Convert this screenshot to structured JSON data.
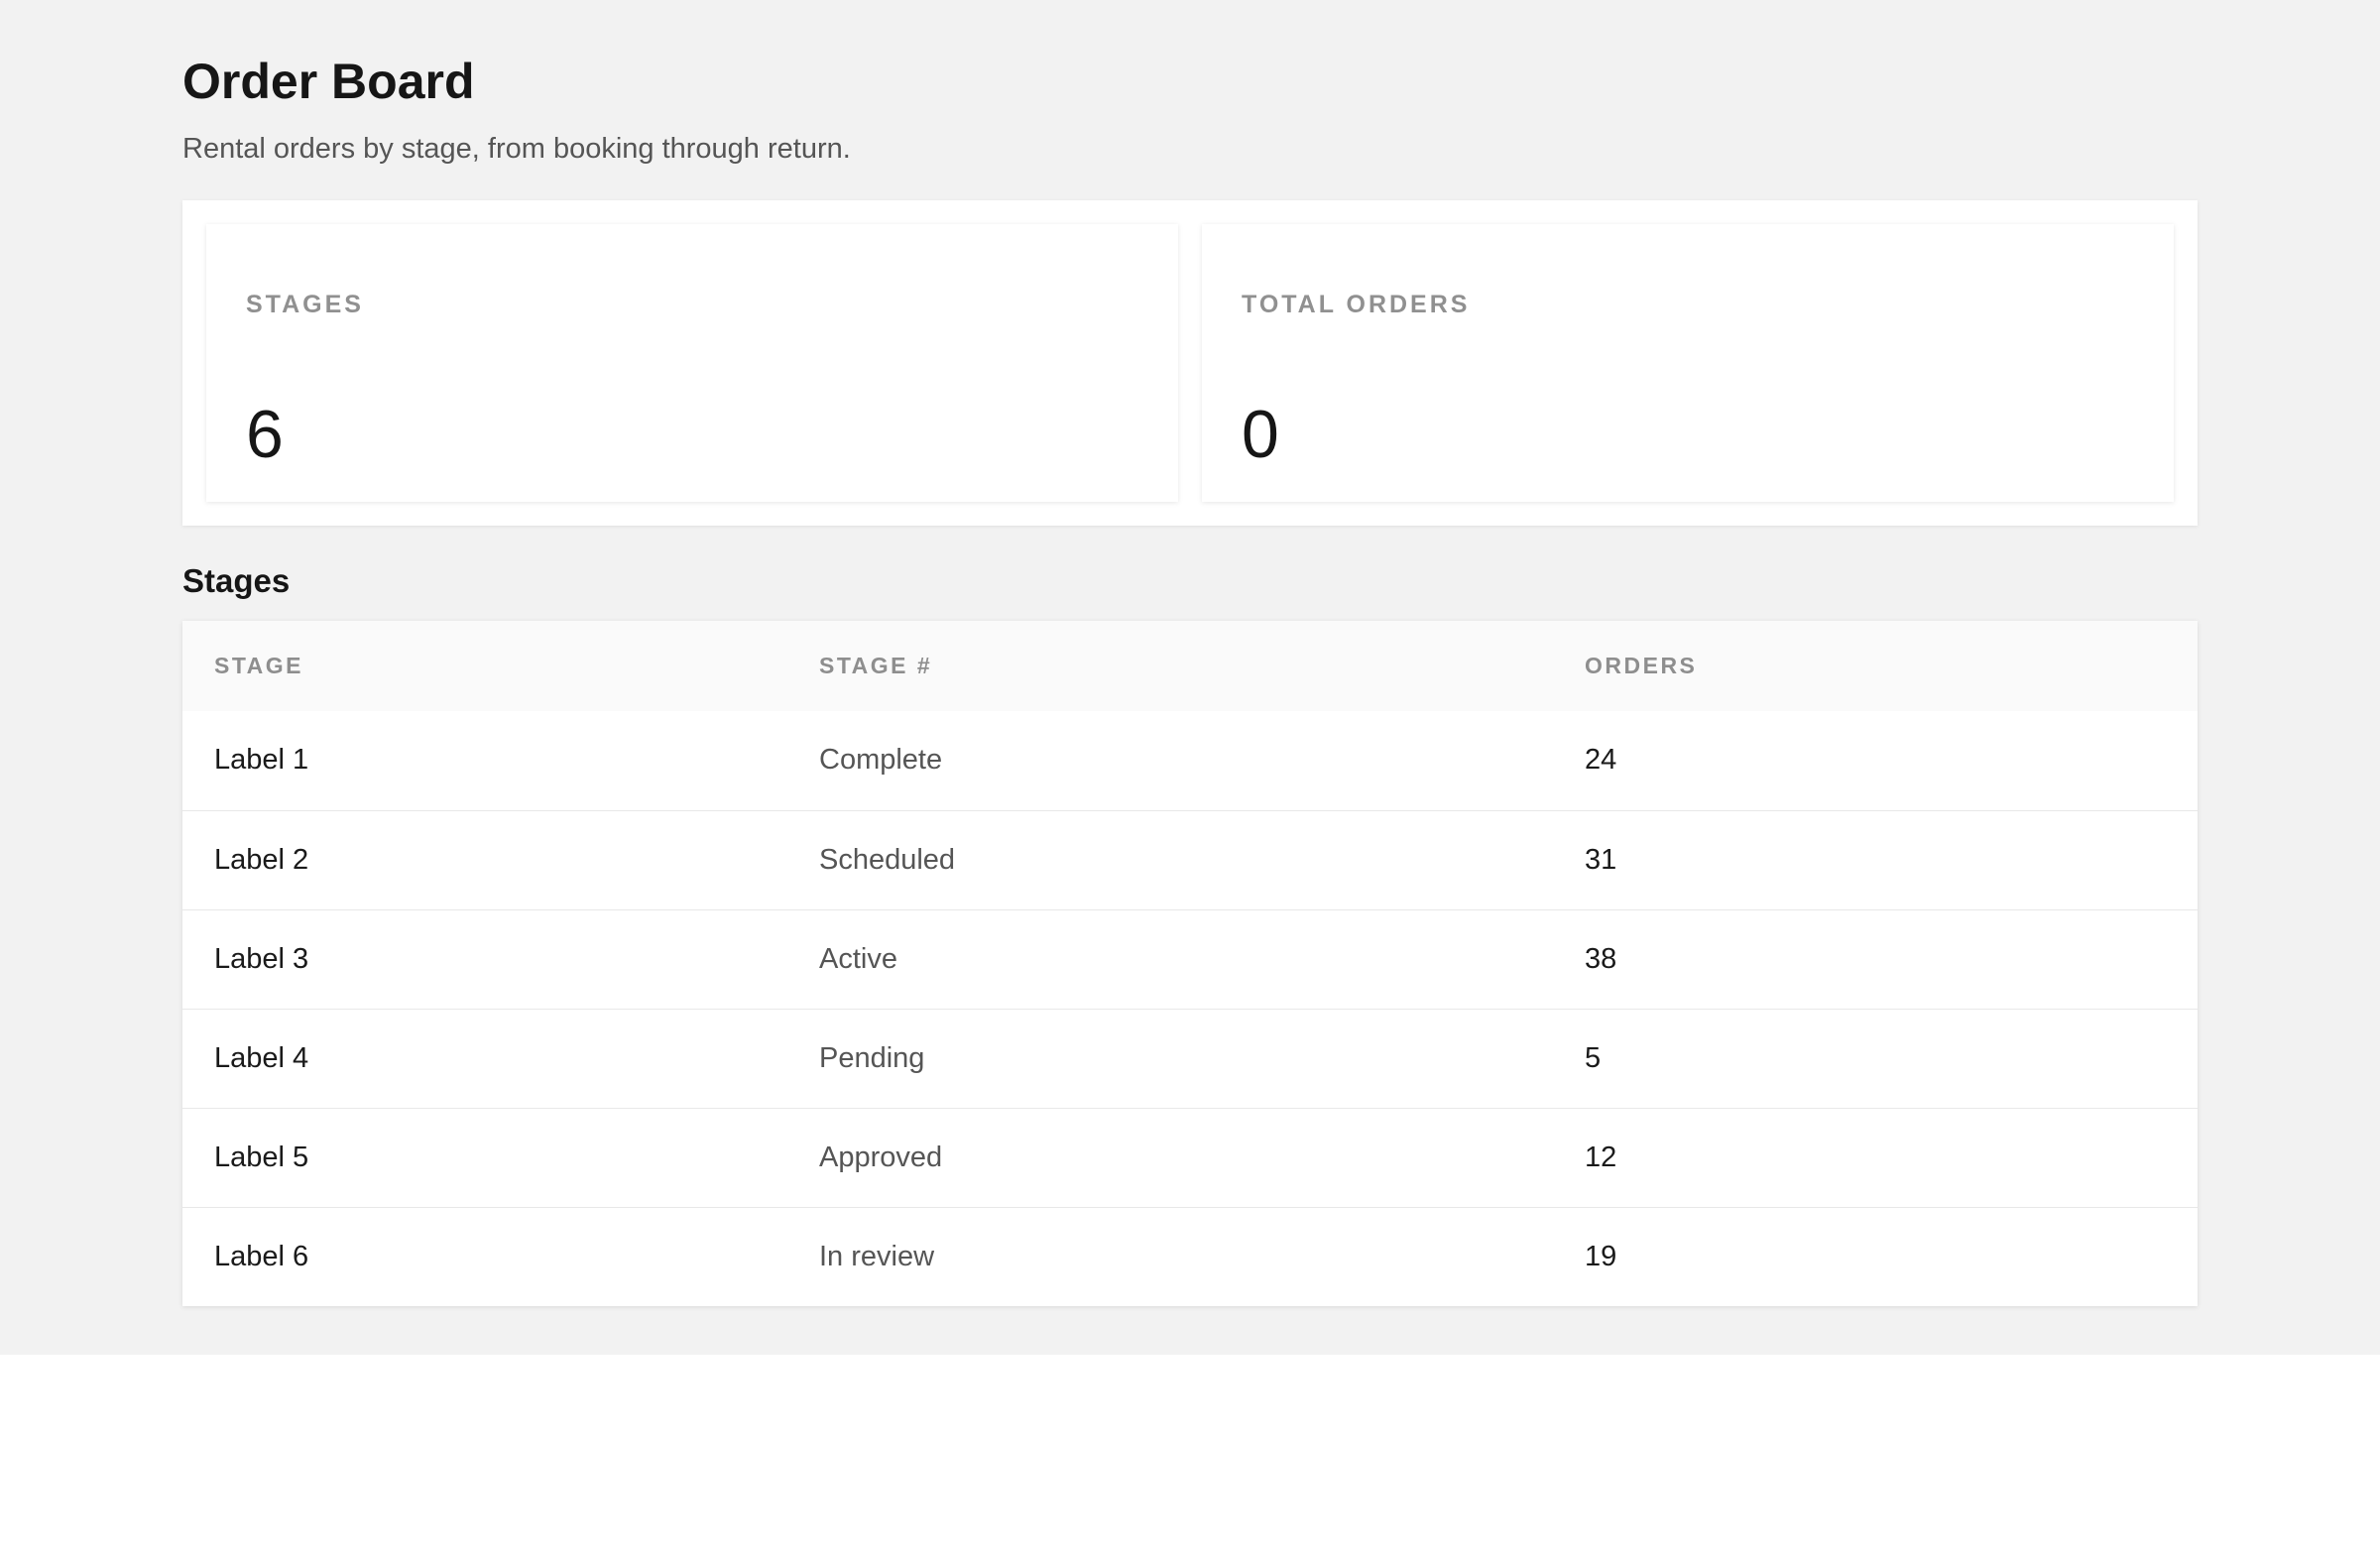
{
  "header": {
    "title": "Order Board",
    "subtitle": "Rental orders by stage, from booking through return."
  },
  "stats": {
    "stages": {
      "label": "STAGES",
      "value": "6"
    },
    "total_orders": {
      "label": "TOTAL ORDERS",
      "value": "0"
    }
  },
  "section": {
    "title": "Stages"
  },
  "table": {
    "columns": [
      "STAGE",
      "STAGE #",
      "ORDERS"
    ],
    "rows": [
      {
        "stage": "Label 1",
        "status": "Complete",
        "orders": "24"
      },
      {
        "stage": "Label 2",
        "status": "Scheduled",
        "orders": "31"
      },
      {
        "stage": "Label 3",
        "status": "Active",
        "orders": "38"
      },
      {
        "stage": "Label 4",
        "status": "Pending",
        "orders": "5"
      },
      {
        "stage": "Label 5",
        "status": "Approved",
        "orders": "12"
      },
      {
        "stage": "Label 6",
        "status": "In review",
        "orders": "19"
      }
    ]
  },
  "colors": {
    "page_background": "#f2f2f2",
    "card_background": "#ffffff",
    "text_primary": "#161616",
    "text_muted": "#909090"
  }
}
